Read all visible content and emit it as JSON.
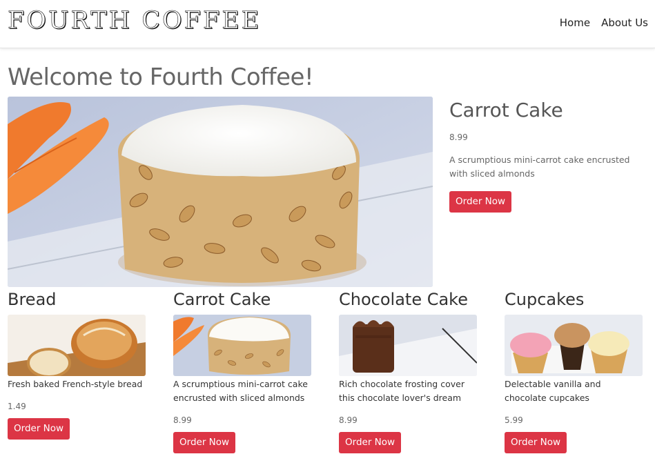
{
  "navbar": {
    "brand": "Fourth Coffee",
    "links": [
      "Home",
      "About Us"
    ]
  },
  "welcome": "Welcome to Fourth Coffee!",
  "featured": {
    "title": "Carrot Cake",
    "price": "8.99",
    "description": "A scrumptious mini-carrot cake encrusted with sliced almonds",
    "button": "Order Now",
    "image_icon": "carrot-cake-photo"
  },
  "products": [
    {
      "title": "Bread",
      "description": "Fresh baked French-style bread",
      "price": "1.49",
      "button": "Order Now",
      "image_icon": "bread-photo"
    },
    {
      "title": "Carrot Cake",
      "description": "A scrumptious mini-carrot cake encrusted with sliced almonds",
      "price": "8.99",
      "button": "Order Now",
      "image_icon": "carrot-cake-photo"
    },
    {
      "title": "Chocolate Cake",
      "description": "Rich chocolate frosting cover this chocolate lover's dream",
      "price": "8.99",
      "button": "Order Now",
      "image_icon": "chocolate-cake-photo"
    },
    {
      "title": "Cupcakes",
      "description": "Delectable vanilla and chocolate cupcakes",
      "price": "5.99",
      "button": "Order Now",
      "image_icon": "cupcakes-photo"
    }
  ],
  "colors": {
    "accent": "#dc3545",
    "text": "#555555"
  }
}
